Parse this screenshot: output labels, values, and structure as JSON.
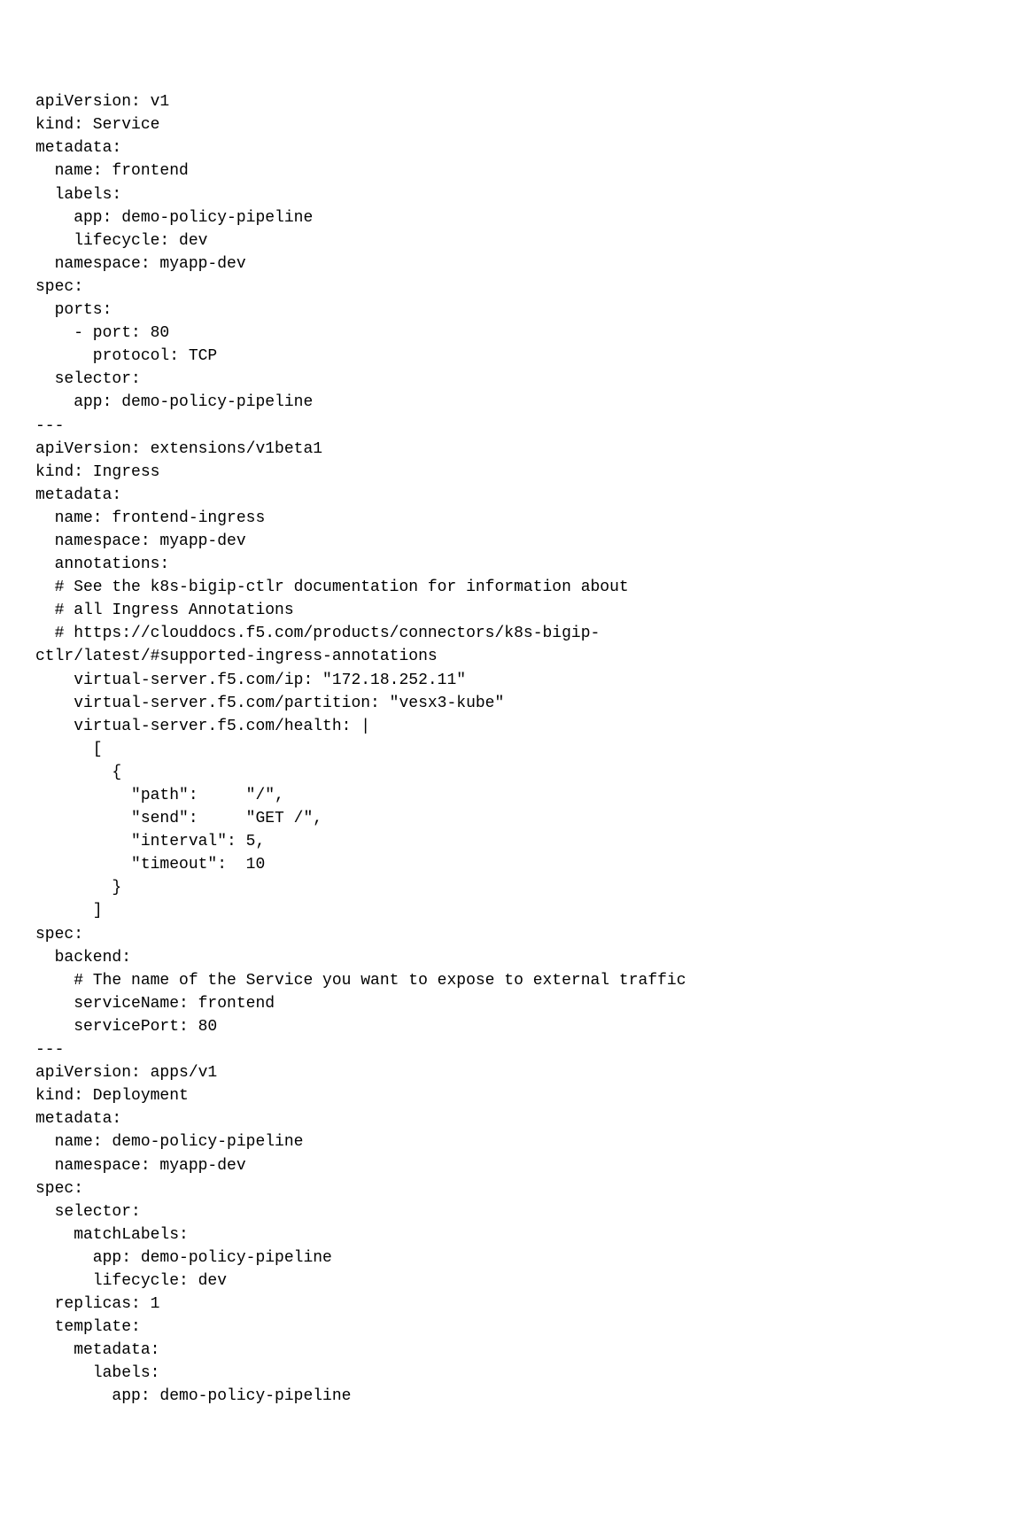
{
  "code": "apiVersion: v1\nkind: Service\nmetadata:\n  name: frontend\n  labels:\n    app: demo-policy-pipeline\n    lifecycle: dev\n  namespace: myapp-dev\nspec:\n  ports:\n    - port: 80\n      protocol: TCP\n  selector:\n    app: demo-policy-pipeline\n---\napiVersion: extensions/v1beta1\nkind: Ingress\nmetadata:\n  name: frontend-ingress\n  namespace: myapp-dev\n  annotations:\n  # See the k8s-bigip-ctlr documentation for information about\n  # all Ingress Annotations\n  # https://clouddocs.f5.com/products/connectors/k8s-bigip-\nctlr/latest/#supported-ingress-annotations\n    virtual-server.f5.com/ip: \"172.18.252.11\"\n    virtual-server.f5.com/partition: \"vesx3-kube\"\n    virtual-server.f5.com/health: |\n      [\n        {\n          \"path\":     \"/\",\n          \"send\":     \"GET /\",\n          \"interval\": 5,\n          \"timeout\":  10\n        }\n      ]\nspec:\n  backend:\n    # The name of the Service you want to expose to external traffic\n    serviceName: frontend\n    servicePort: 80\n---\napiVersion: apps/v1\nkind: Deployment\nmetadata:\n  name: demo-policy-pipeline\n  namespace: myapp-dev\nspec:\n  selector:\n    matchLabels:\n      app: demo-policy-pipeline\n      lifecycle: dev\n  replicas: 1\n  template:\n    metadata:\n      labels:\n        app: demo-policy-pipeline"
}
